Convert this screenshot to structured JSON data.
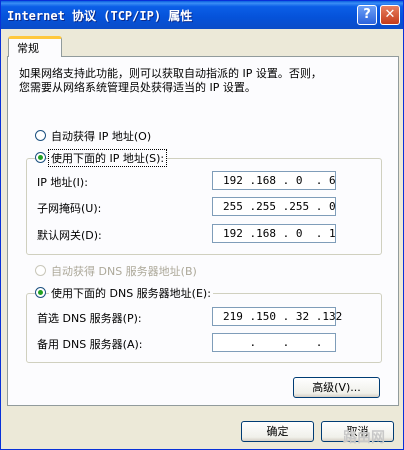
{
  "window": {
    "title": "Internet 协议 (TCP/IP) 属性",
    "help_button": "?",
    "close_button": "✕"
  },
  "tabs": [
    {
      "label": "常规",
      "selected": true
    }
  ],
  "description": "如果网络支持此功能，则可以获取自动指派的 IP 设置。否则，\n您需要从网络系统管理员处获得适当的 IP 设置。",
  "ip_mode": {
    "auto_label": "自动获得 IP 地址(O)",
    "auto_selected": false,
    "manual_label": "使用下面的 IP 地址(S):",
    "manual_selected": true
  },
  "ip_fields": {
    "ip_label": "IP 地址(I):",
    "ip_value": "192 .168 . 0  . 6",
    "mask_label": "子网掩码(U):",
    "mask_value": "255 .255 .255 . 0",
    "gateway_label": "默认网关(D):",
    "gateway_value": "192 .168 . 0  . 1"
  },
  "dns_mode": {
    "auto_label": "自动获得 DNS 服务器地址(B)",
    "auto_selected": false,
    "auto_disabled": true,
    "manual_label": "使用下面的 DNS 服务器地址(E):",
    "manual_selected": true
  },
  "dns_fields": {
    "preferred_label": "首选 DNS 服务器(P):",
    "preferred_value": "219 .150 . 32 .132",
    "alternate_label": "备用 DNS 服务器(A):",
    "alternate_value": "    .    .    .    "
  },
  "buttons": {
    "advanced": "高级(V)...",
    "ok": "确定",
    "cancel": "取消"
  },
  "watermark": "路由网"
}
